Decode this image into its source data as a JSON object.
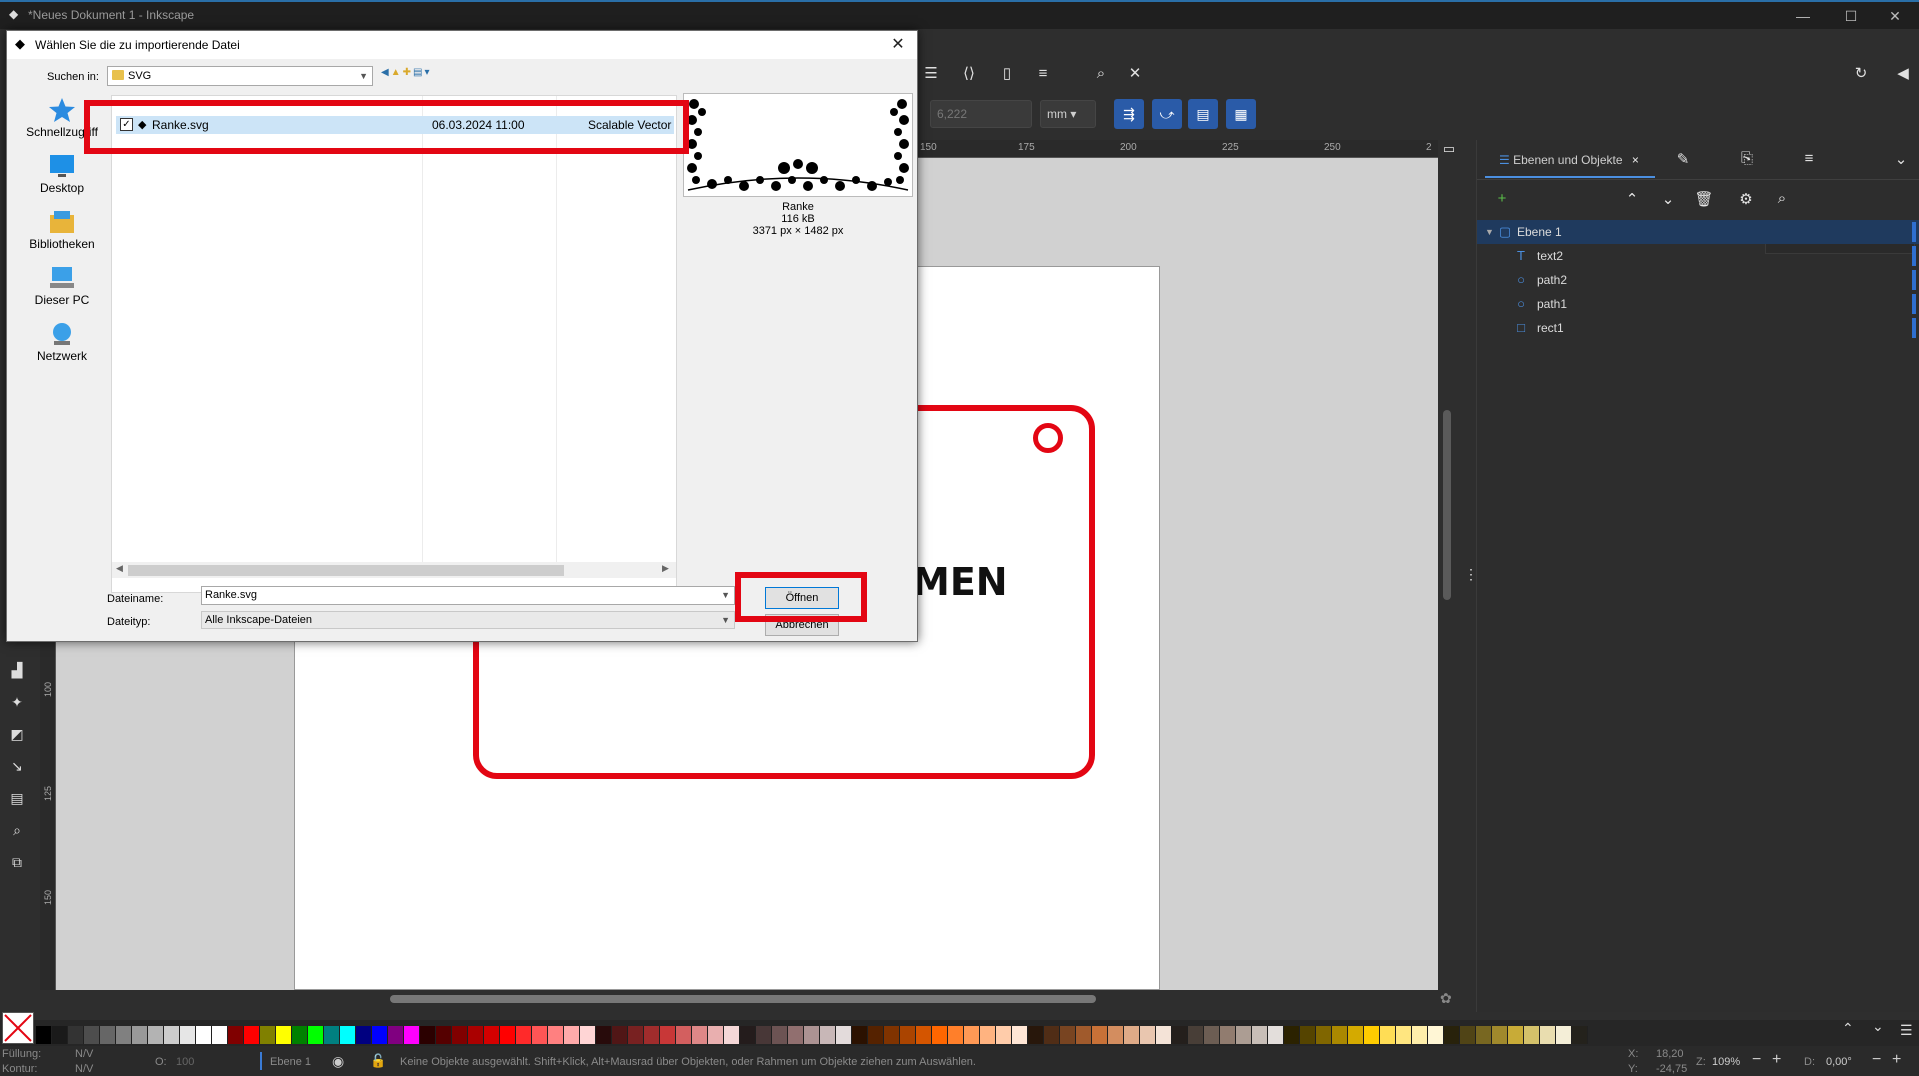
{
  "window": {
    "title": "*Neues Dokument 1 - Inkscape",
    "minimize": "—",
    "maximize": "☐",
    "close": "✕"
  },
  "toolbar": {
    "width_value": "6,222",
    "unit": "mm"
  },
  "ruler": {
    "h_ticks": [
      "150",
      "175",
      "200",
      "225",
      "250",
      "2"
    ],
    "v_ticks": [
      "100",
      "125",
      "150"
    ]
  },
  "canvas": {
    "visible_text": "MEN"
  },
  "panel": {
    "tab_label": "Ebenen und Objekte",
    "tab_close": "×",
    "layers": [
      {
        "label": "Ebene 1",
        "type": "layer"
      },
      {
        "label": "text2",
        "type": "text"
      },
      {
        "label": "path2",
        "type": "circle"
      },
      {
        "label": "path1",
        "type": "circle"
      },
      {
        "label": "rect1",
        "type": "rect"
      }
    ]
  },
  "palette": {
    "swatches": [
      "#000000",
      "#1a1a1a",
      "#333333",
      "#4d4d4d",
      "#666666",
      "#808080",
      "#999999",
      "#b3b3b3",
      "#cccccc",
      "#e6e6e6",
      "#ffffff",
      "#ffffff",
      "#800000",
      "#ff0000",
      "#808000",
      "#ffff00",
      "#008000",
      "#00ff00",
      "#008080",
      "#00ffff",
      "#000080",
      "#0000ff",
      "#800080",
      "#ff00ff",
      "#2b0000",
      "#550000",
      "#800000",
      "#aa0000",
      "#d40000",
      "#ff0000",
      "#ff2a2a",
      "#ff5555",
      "#ff8080",
      "#ffaaaa",
      "#ffd5d5",
      "#280b0b",
      "#501616",
      "#782121",
      "#a02c2c",
      "#c83737",
      "#d35f5f",
      "#de8787",
      "#e9afaf",
      "#f4d7d7",
      "#241c1c",
      "#483737",
      "#6c5353",
      "#916f6f",
      "#ac9393",
      "#c8b7b7",
      "#e3dbdb",
      "#2b1100",
      "#552200",
      "#803300",
      "#aa4400",
      "#d45500",
      "#ff6600",
      "#ff7f2a",
      "#ff9955",
      "#ffb380",
      "#ffccaa",
      "#ffe6d5",
      "#28170b",
      "#502d16",
      "#784421",
      "#a05a2c",
      "#c87137",
      "#d38d5f",
      "#deaa87",
      "#e9c6af",
      "#f4e3d7",
      "#241f1c",
      "#483e37",
      "#6c5d53",
      "#917c6f",
      "#ac9d93",
      "#c8beb7",
      "#e3dedb",
      "#2b2200",
      "#554400",
      "#806600",
      "#aa8800",
      "#d4aa00",
      "#ffcc00",
      "#ffdd55",
      "#ffe680",
      "#ffeeaa",
      "#fff6d5",
      "#28220b",
      "#504416",
      "#786721",
      "#a0892c",
      "#c8ab37",
      "#d4c16a",
      "#e9ddaf",
      "#f4eed7",
      "#24221c"
    ]
  },
  "status": {
    "fill_label": "Füllung:",
    "fill_value": "N/V",
    "stroke_label": "Kontur:",
    "stroke_value": "N/V",
    "opacity_label": "O:",
    "opacity_value": "100",
    "layer": "Ebene 1",
    "message": "Keine Objekte ausgewählt. Shift+Klick, Alt+Mausrad über Objekten, oder Rahmen um Objekte ziehen zum Auswählen.",
    "x_label": "X:",
    "x_value": "18,20",
    "y_label": "Y:",
    "y_value": "-24,75",
    "zoom_label": "Z:",
    "zoom_value": "109%",
    "rotation_label": "D:",
    "rotation_value": "0,00°"
  },
  "dialog": {
    "title": "Wählen Sie die zu importierende Datei",
    "lookin_label": "Suchen in:",
    "lookin_value": "SVG",
    "places": [
      "Schnellzugriff",
      "Desktop",
      "Bibliotheken",
      "Dieser PC",
      "Netzwerk"
    ],
    "file": {
      "name": "Ranke.svg",
      "date": "06.03.2024 11:00",
      "type": "Scalable Vector Gr"
    },
    "preview": {
      "name": "Ranke",
      "size": "116 kB",
      "dimensions": "3371 px × 1482 px"
    },
    "filename_label": "Dateiname:",
    "filename_value": "Ranke.svg",
    "filetype_label": "Dateityp:",
    "filetype_value": "Alle Inkscape-Dateien",
    "open_label": "Öffnen",
    "cancel_label": "Abbrechen"
  }
}
